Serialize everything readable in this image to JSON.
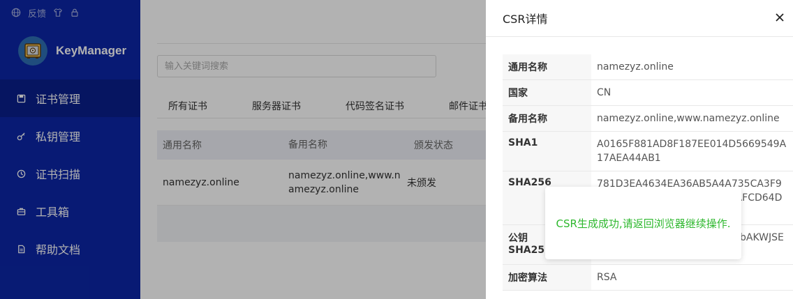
{
  "topbar": {
    "feedback_label": "反馈"
  },
  "brand": {
    "name": "KeyManager"
  },
  "sidebar": {
    "items": [
      {
        "label": "证书管理",
        "icon": "save-icon",
        "active": true
      },
      {
        "label": "私钥管理",
        "icon": "key-icon",
        "active": false
      },
      {
        "label": "证书扫描",
        "icon": "scan-icon",
        "active": false
      },
      {
        "label": "工具箱",
        "icon": "toolbox-icon",
        "active": false
      },
      {
        "label": "帮助文档",
        "icon": "document-icon",
        "active": false
      }
    ]
  },
  "main": {
    "search": {
      "placeholder": "输入关键词搜索"
    },
    "tabs": [
      {
        "label": "所有证书"
      },
      {
        "label": "服务器证书"
      },
      {
        "label": "代码签名证书"
      },
      {
        "label": "邮件证书"
      }
    ],
    "table": {
      "headers": [
        "通用名称",
        "备用名称",
        "颁发状态"
      ],
      "rows": [
        {
          "common_name": "namezyz.online",
          "alt_names": "namezyz.online,www.namezyz.online",
          "status": "未颁发"
        }
      ]
    }
  },
  "drawer": {
    "title": "CSR详情",
    "fields": [
      {
        "label": "通用名称",
        "value": "namezyz.online"
      },
      {
        "label": "国家",
        "value": "CN"
      },
      {
        "label": "备用名称",
        "value": "namezyz.online,www.namezyz.online"
      },
      {
        "label": "SHA1",
        "value": "A0165F881AD8F187EE014D5669549A17AEA44AB1"
      },
      {
        "label": "SHA256",
        "value": "781D3EA4634EA36AB5A4A735CA3F9C593990E63D5C7E9F81049AFCD64DE"
      },
      {
        "label": "公钥SHA256PIN",
        "value": "cGhfeRWVT8ePOrhNk4iUwZqbAKWJSEcQ"
      },
      {
        "label": "加密算法",
        "value": "RSA"
      }
    ]
  },
  "toast": {
    "message": "CSR生成成功,请返回浏览器继续操作."
  },
  "colors": {
    "sidebar": "#0c26a6",
    "toast_text": "#2eb82e"
  }
}
